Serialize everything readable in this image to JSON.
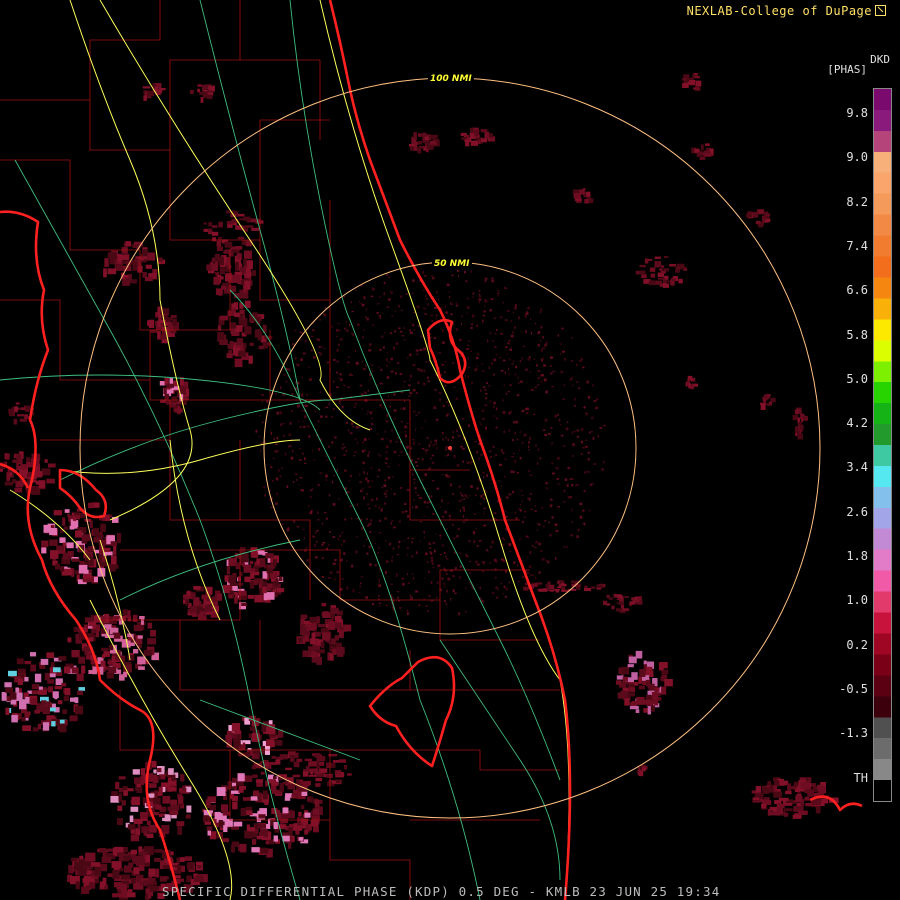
{
  "header": {
    "credit": "NEXLAB-College of DuPage",
    "product_code": "DKD",
    "units": "[PHAS]"
  },
  "footer": {
    "title": "SPECIFIC DIFFERENTIAL PHASE (KDP) 0.5 DEG - KMLB 23 JUN 25 19:34"
  },
  "range_rings": [
    {
      "label": "100 NMI"
    },
    {
      "label": "50 NMI"
    }
  ],
  "colorbar": {
    "ticks": [
      "9.8",
      "9.0",
      "8.2",
      "7.4",
      "6.6",
      "5.8",
      "5.0",
      "4.2",
      "3.4",
      "2.6",
      "1.8",
      "1.0",
      "0.2",
      "-0.5",
      "-1.3",
      "TH"
    ],
    "colors": [
      "#7a0a6e",
      "#8a1a7c",
      "#b4447a",
      "#f7b07a",
      "#f9a56c",
      "#f49a5a",
      "#f28a46",
      "#f17c30",
      "#f26e1c",
      "#f5860f",
      "#f9b10a",
      "#fde800",
      "#dcff00",
      "#7cf000",
      "#27d400",
      "#16b316",
      "#239a2c",
      "#3ec9a3",
      "#55e8f0",
      "#83c0ec",
      "#a2a6e8",
      "#c28ad4",
      "#e27cc8",
      "#f05aa6",
      "#e33a6c",
      "#c8143c",
      "#9e0624",
      "#7a0018",
      "#5a0012",
      "#3c000c",
      "#505050",
      "#6c6c6c",
      "#888888",
      "#000000"
    ]
  },
  "colors": {
    "coastline": "#ff2020",
    "county_lines": "#b01010",
    "highways": "#ffff66",
    "roads": "#44cc88",
    "range_ring": "#ffcc88",
    "echo_primary": "#7a0a22",
    "echo_highlight": "#ff88cc"
  }
}
